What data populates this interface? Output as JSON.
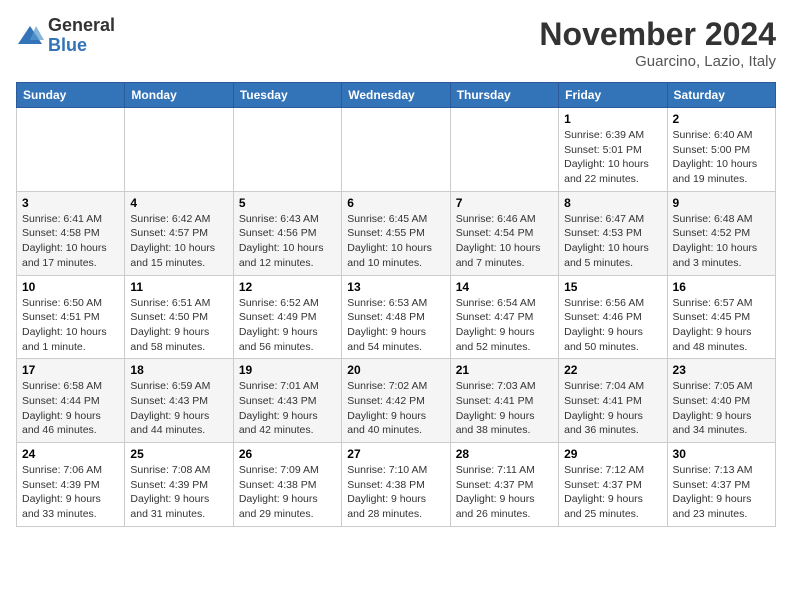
{
  "header": {
    "logo_general": "General",
    "logo_blue": "Blue",
    "month_title": "November 2024",
    "location": "Guarcino, Lazio, Italy"
  },
  "weekdays": [
    "Sunday",
    "Monday",
    "Tuesday",
    "Wednesday",
    "Thursday",
    "Friday",
    "Saturday"
  ],
  "weeks": [
    [
      {
        "day": "",
        "info": ""
      },
      {
        "day": "",
        "info": ""
      },
      {
        "day": "",
        "info": ""
      },
      {
        "day": "",
        "info": ""
      },
      {
        "day": "",
        "info": ""
      },
      {
        "day": "1",
        "info": "Sunrise: 6:39 AM\nSunset: 5:01 PM\nDaylight: 10 hours and 22 minutes."
      },
      {
        "day": "2",
        "info": "Sunrise: 6:40 AM\nSunset: 5:00 PM\nDaylight: 10 hours and 19 minutes."
      }
    ],
    [
      {
        "day": "3",
        "info": "Sunrise: 6:41 AM\nSunset: 4:58 PM\nDaylight: 10 hours and 17 minutes."
      },
      {
        "day": "4",
        "info": "Sunrise: 6:42 AM\nSunset: 4:57 PM\nDaylight: 10 hours and 15 minutes."
      },
      {
        "day": "5",
        "info": "Sunrise: 6:43 AM\nSunset: 4:56 PM\nDaylight: 10 hours and 12 minutes."
      },
      {
        "day": "6",
        "info": "Sunrise: 6:45 AM\nSunset: 4:55 PM\nDaylight: 10 hours and 10 minutes."
      },
      {
        "day": "7",
        "info": "Sunrise: 6:46 AM\nSunset: 4:54 PM\nDaylight: 10 hours and 7 minutes."
      },
      {
        "day": "8",
        "info": "Sunrise: 6:47 AM\nSunset: 4:53 PM\nDaylight: 10 hours and 5 minutes."
      },
      {
        "day": "9",
        "info": "Sunrise: 6:48 AM\nSunset: 4:52 PM\nDaylight: 10 hours and 3 minutes."
      }
    ],
    [
      {
        "day": "10",
        "info": "Sunrise: 6:50 AM\nSunset: 4:51 PM\nDaylight: 10 hours and 1 minute."
      },
      {
        "day": "11",
        "info": "Sunrise: 6:51 AM\nSunset: 4:50 PM\nDaylight: 9 hours and 58 minutes."
      },
      {
        "day": "12",
        "info": "Sunrise: 6:52 AM\nSunset: 4:49 PM\nDaylight: 9 hours and 56 minutes."
      },
      {
        "day": "13",
        "info": "Sunrise: 6:53 AM\nSunset: 4:48 PM\nDaylight: 9 hours and 54 minutes."
      },
      {
        "day": "14",
        "info": "Sunrise: 6:54 AM\nSunset: 4:47 PM\nDaylight: 9 hours and 52 minutes."
      },
      {
        "day": "15",
        "info": "Sunrise: 6:56 AM\nSunset: 4:46 PM\nDaylight: 9 hours and 50 minutes."
      },
      {
        "day": "16",
        "info": "Sunrise: 6:57 AM\nSunset: 4:45 PM\nDaylight: 9 hours and 48 minutes."
      }
    ],
    [
      {
        "day": "17",
        "info": "Sunrise: 6:58 AM\nSunset: 4:44 PM\nDaylight: 9 hours and 46 minutes."
      },
      {
        "day": "18",
        "info": "Sunrise: 6:59 AM\nSunset: 4:43 PM\nDaylight: 9 hours and 44 minutes."
      },
      {
        "day": "19",
        "info": "Sunrise: 7:01 AM\nSunset: 4:43 PM\nDaylight: 9 hours and 42 minutes."
      },
      {
        "day": "20",
        "info": "Sunrise: 7:02 AM\nSunset: 4:42 PM\nDaylight: 9 hours and 40 minutes."
      },
      {
        "day": "21",
        "info": "Sunrise: 7:03 AM\nSunset: 4:41 PM\nDaylight: 9 hours and 38 minutes."
      },
      {
        "day": "22",
        "info": "Sunrise: 7:04 AM\nSunset: 4:41 PM\nDaylight: 9 hours and 36 minutes."
      },
      {
        "day": "23",
        "info": "Sunrise: 7:05 AM\nSunset: 4:40 PM\nDaylight: 9 hours and 34 minutes."
      }
    ],
    [
      {
        "day": "24",
        "info": "Sunrise: 7:06 AM\nSunset: 4:39 PM\nDaylight: 9 hours and 33 minutes."
      },
      {
        "day": "25",
        "info": "Sunrise: 7:08 AM\nSunset: 4:39 PM\nDaylight: 9 hours and 31 minutes."
      },
      {
        "day": "26",
        "info": "Sunrise: 7:09 AM\nSunset: 4:38 PM\nDaylight: 9 hours and 29 minutes."
      },
      {
        "day": "27",
        "info": "Sunrise: 7:10 AM\nSunset: 4:38 PM\nDaylight: 9 hours and 28 minutes."
      },
      {
        "day": "28",
        "info": "Sunrise: 7:11 AM\nSunset: 4:37 PM\nDaylight: 9 hours and 26 minutes."
      },
      {
        "day": "29",
        "info": "Sunrise: 7:12 AM\nSunset: 4:37 PM\nDaylight: 9 hours and 25 minutes."
      },
      {
        "day": "30",
        "info": "Sunrise: 7:13 AM\nSunset: 4:37 PM\nDaylight: 9 hours and 23 minutes."
      }
    ]
  ]
}
